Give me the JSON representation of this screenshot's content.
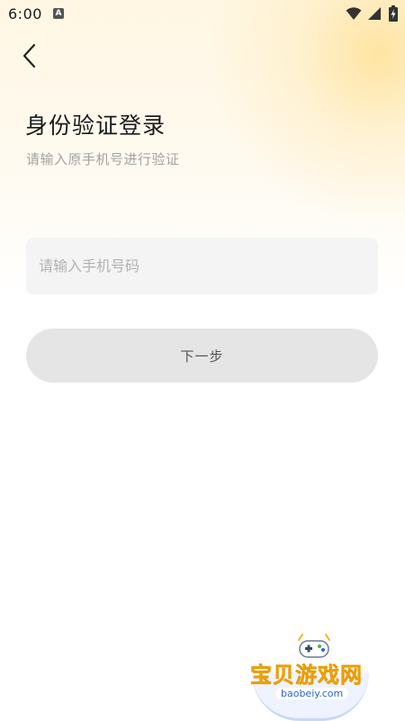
{
  "status_bar": {
    "time": "6:00",
    "app_icon_letter": "A"
  },
  "header": {
    "title": "身份验证登录",
    "subtitle": "请输入原手机号进行验证"
  },
  "form": {
    "phone_value": "",
    "phone_placeholder": "请输入手机号码",
    "next_label": "下一步"
  },
  "watermark": {
    "name": "宝贝游戏网",
    "domain": "baobeiy.com"
  },
  "colors": {
    "background_glow": "#ffe096",
    "input_bg": "#f4f4f4",
    "button_bg": "#e5e5e5",
    "watermark_text": "#f6b21a",
    "watermark_domain": "#2a66c8"
  }
}
